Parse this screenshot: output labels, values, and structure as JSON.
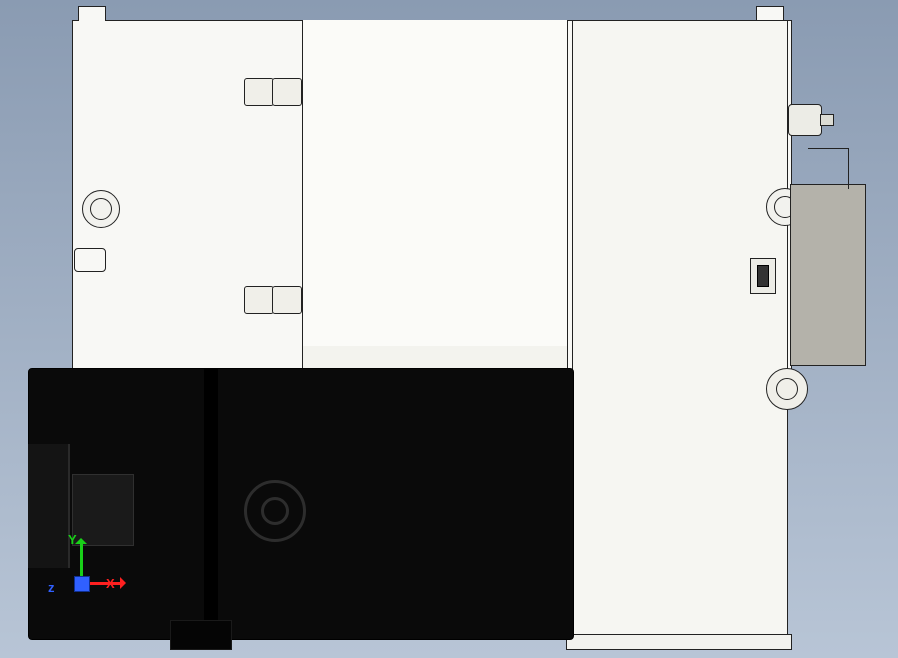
{
  "triad": {
    "x_label": "X",
    "y_label": "Y",
    "z_label": "z"
  },
  "colors": {
    "axis_x": "#ff2020",
    "axis_y": "#18d018",
    "axis_z": "#3060ff",
    "model_body": "#f8f8f5",
    "motor": "#0a0a0a",
    "bracket": "#b4b2aa"
  }
}
